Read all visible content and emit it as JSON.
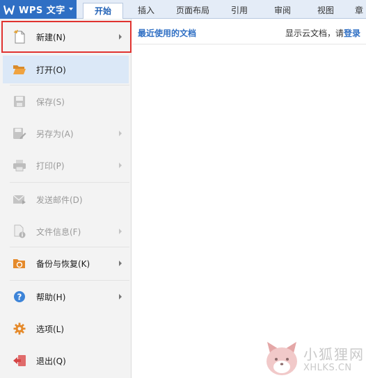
{
  "app": {
    "title": "WPS 文字"
  },
  "tabs": [
    {
      "label": "开始",
      "active": true
    },
    {
      "label": "插入"
    },
    {
      "label": "页面布局"
    },
    {
      "label": "引用"
    },
    {
      "label": "审阅"
    },
    {
      "label": "视图"
    },
    {
      "label": "章"
    }
  ],
  "menu": {
    "items": [
      {
        "label": "新建(N)",
        "icon": "new-document-icon",
        "has_submenu": true,
        "enabled": true,
        "highlighted": true
      },
      {
        "label": "打开(O)",
        "icon": "open-folder-icon",
        "has_submenu": false,
        "enabled": true,
        "hover": true
      },
      {
        "label": "保存(S)",
        "icon": "save-icon",
        "has_submenu": false,
        "enabled": false
      },
      {
        "label": "另存为(A)",
        "icon": "save-as-icon",
        "has_submenu": true,
        "enabled": false
      },
      {
        "label": "打印(P)",
        "icon": "print-icon",
        "has_submenu": true,
        "enabled": false
      },
      {
        "label": "发送邮件(D)",
        "icon": "mail-icon",
        "has_submenu": false,
        "enabled": false
      },
      {
        "label": "文件信息(F)",
        "icon": "file-info-icon",
        "has_submenu": true,
        "enabled": false
      },
      {
        "label": "备份与恢复(K)",
        "icon": "backup-restore-icon",
        "has_submenu": true,
        "enabled": true
      },
      {
        "label": "帮助(H)",
        "icon": "help-icon",
        "has_submenu": true,
        "enabled": true
      },
      {
        "label": "选项(L)",
        "icon": "gear-icon",
        "has_submenu": false,
        "enabled": true
      },
      {
        "label": "退出(Q)",
        "icon": "exit-icon",
        "has_submenu": false,
        "enabled": true
      }
    ]
  },
  "recent": {
    "title": "最近使用的文档",
    "cloud_prefix": "显示云文档，请",
    "cloud_login": "登录"
  },
  "watermark": {
    "cn": "小狐狸网",
    "en": "XHLKS.CN"
  },
  "colors": {
    "brand": "#2f6fc4",
    "highlight_border": "#e0322f",
    "hover_bg": "#dbe8f7"
  }
}
